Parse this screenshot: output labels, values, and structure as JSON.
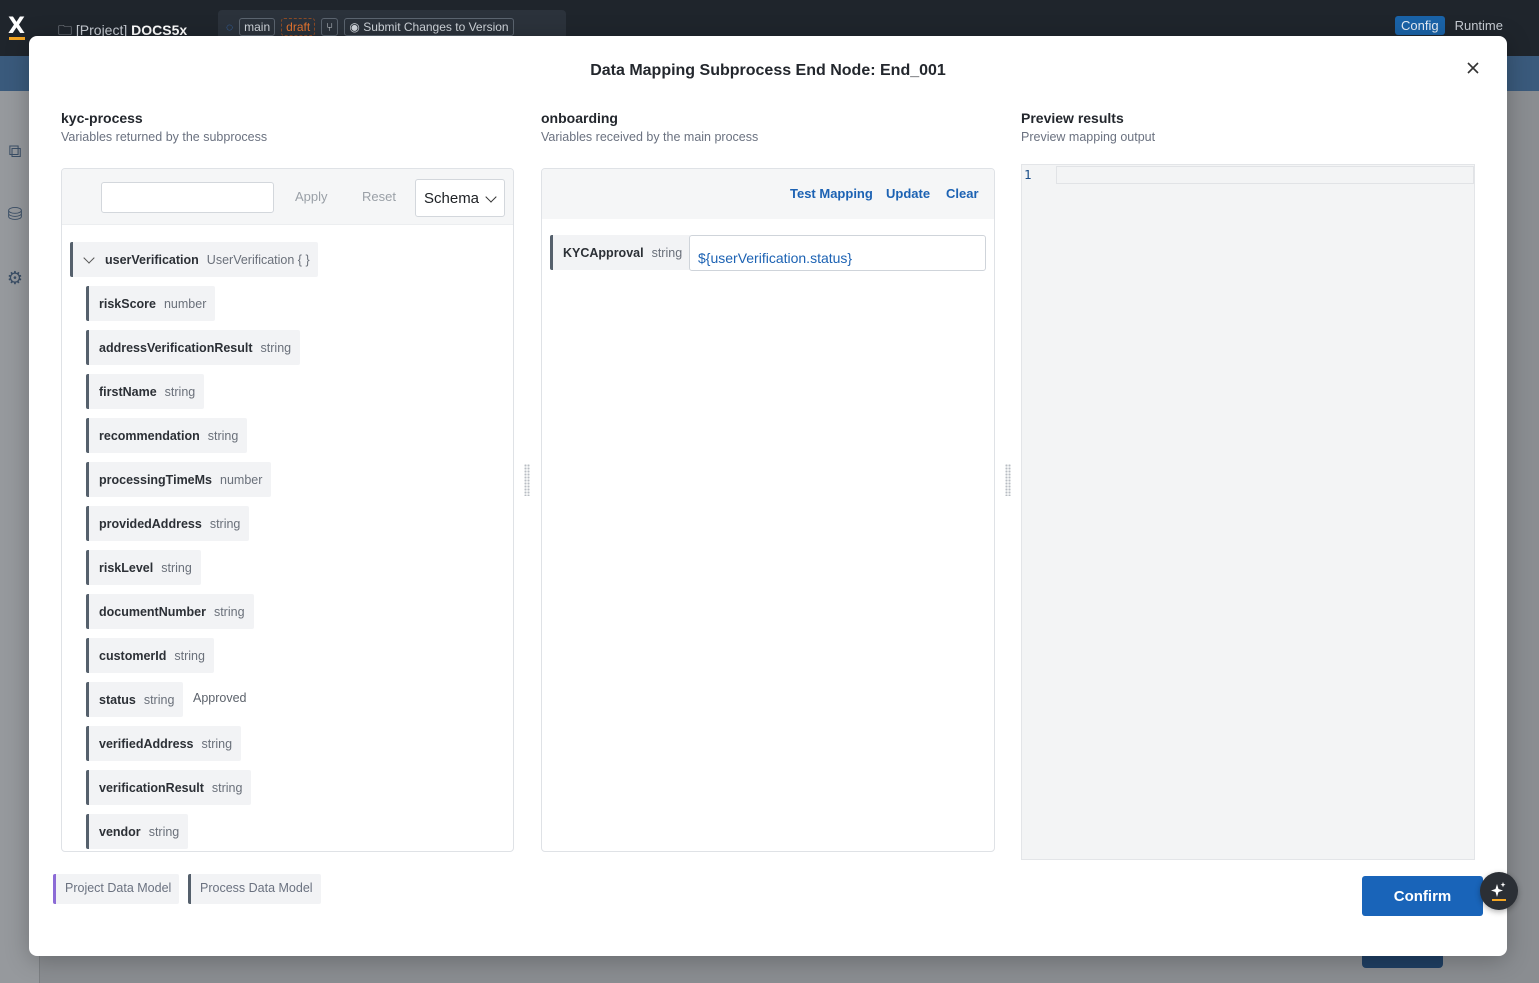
{
  "app": {
    "project_prefix": "[Project]",
    "project_name": "DOCS5x",
    "branch": "main",
    "status": "draft",
    "submit_label": "Submit Changes to Version",
    "tab_config": "Config",
    "tab_runtime": "Runtime"
  },
  "modal": {
    "title": "Data Mapping Subprocess End Node: End_001"
  },
  "source": {
    "heading": "kyc-process",
    "subheading": "Variables returned by the subprocess",
    "search_value": "",
    "apply_label": "Apply",
    "reset_label": "Reset",
    "view_select": "Schema",
    "root": {
      "name": "userVerification",
      "type": "UserVerification { }"
    },
    "fields": [
      {
        "name": "riskScore",
        "type": "number",
        "value": ""
      },
      {
        "name": "addressVerificationResult",
        "type": "string",
        "value": ""
      },
      {
        "name": "firstName",
        "type": "string",
        "value": ""
      },
      {
        "name": "recommendation",
        "type": "string",
        "value": ""
      },
      {
        "name": "processingTimeMs",
        "type": "number",
        "value": ""
      },
      {
        "name": "providedAddress",
        "type": "string",
        "value": ""
      },
      {
        "name": "riskLevel",
        "type": "string",
        "value": ""
      },
      {
        "name": "documentNumber",
        "type": "string",
        "value": ""
      },
      {
        "name": "customerId",
        "type": "string",
        "value": ""
      },
      {
        "name": "status",
        "type": "string",
        "value": "Approved"
      },
      {
        "name": "verifiedAddress",
        "type": "string",
        "value": ""
      },
      {
        "name": "verificationResult",
        "type": "string",
        "value": ""
      },
      {
        "name": "vendor",
        "type": "string",
        "value": ""
      }
    ]
  },
  "target": {
    "heading": "onboarding",
    "subheading": "Variables received by the main process",
    "test_label": "Test Mapping",
    "update_label": "Update",
    "clear_label": "Clear",
    "variable": {
      "name": "KYCApproval",
      "type": "string",
      "expression": "${userVerification.status}"
    }
  },
  "preview": {
    "heading": "Preview results",
    "subheading": "Preview mapping output",
    "line_number": "1"
  },
  "footer": {
    "legend_project": "Project Data Model",
    "legend_process": "Process Data Model",
    "confirm_label": "Confirm"
  },
  "colors": {
    "accent": "#1964b9",
    "project_model": "#8c6bd6",
    "process_model": "#55606c"
  }
}
